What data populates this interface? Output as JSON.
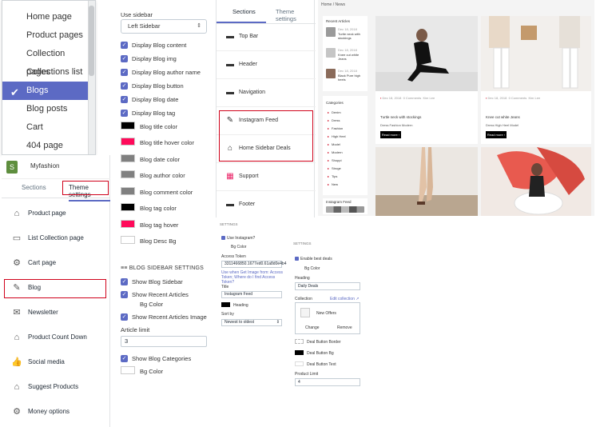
{
  "dropdown": {
    "items": [
      "Home page",
      "Product pages",
      "Collection pages",
      "Collections list",
      "Blogs",
      "Blog posts",
      "Cart",
      "404 page"
    ],
    "selected": "Blogs"
  },
  "left_panel": {
    "shop_name": "Myfashion",
    "tabs": [
      "Sections",
      "Theme settings"
    ],
    "items": [
      {
        "label": "Product page",
        "icon": "tag-icon"
      },
      {
        "label": "List Collection page",
        "icon": "book-icon"
      },
      {
        "label": "Cart page",
        "icon": "gear-icon"
      },
      {
        "label": "Blog",
        "icon": "edit-icon"
      },
      {
        "label": "Newsletter",
        "icon": "mail-icon"
      },
      {
        "label": "Product Count Down",
        "icon": "tag-icon"
      },
      {
        "label": "Social media",
        "icon": "thumbs-up-icon"
      },
      {
        "label": "Suggest Products",
        "icon": "tag-icon"
      },
      {
        "label": "Money options",
        "icon": "gear-icon"
      }
    ]
  },
  "blog_settings": {
    "use_sidebar_label": "Use sidebar",
    "use_sidebar_value": "Left Sidebar",
    "checks": [
      "Display Blog content",
      "Display Blog img",
      "Display Blog author name",
      "Display Blog button",
      "Display Blog date",
      "Display Blog tag"
    ],
    "colors": [
      {
        "label": "Blog title color",
        "color": "#000000"
      },
      {
        "label": "Blog title hover color",
        "color": "#ff0a5a"
      },
      {
        "label": "Blog date color",
        "color": "#808080"
      },
      {
        "label": "Blog author color",
        "color": "#808080"
      },
      {
        "label": "Blog comment color",
        "color": "#808080"
      },
      {
        "label": "Blog tag color",
        "color": "#000000"
      },
      {
        "label": "Blog tag hover",
        "color": "#ff0a5a"
      },
      {
        "label": "Blog Desc Bg",
        "color": "#ffffff"
      }
    ],
    "sidebar_section_title": "BLOG SIDEBAR SETTINGS",
    "show_blog_sidebar": "Show Blog Sidebar",
    "show_recent_articles": "Show Recent Articles",
    "bg_color": "Bg Color",
    "show_recent_image": "Show Recent Articles Image",
    "article_limit_label": "Article limit",
    "article_limit_value": "3",
    "show_categories": "Show Blog Categories",
    "bg_color_2": "Bg Color"
  },
  "sections_panel": {
    "tabs": [
      "Sections",
      "Theme settings"
    ],
    "items": [
      {
        "label": "Top Bar",
        "icon": "layout-icon"
      },
      {
        "label": "Header",
        "icon": "layout-icon"
      },
      {
        "label": "Navigation",
        "icon": "layout-icon"
      },
      {
        "label": "Instagram Feed",
        "icon": "edit-icon"
      },
      {
        "label": "Home Sidebar Deals",
        "icon": "store-icon"
      },
      {
        "label": "Support",
        "icon": "image-icon"
      },
      {
        "label": "Footer",
        "icon": "layout-icon"
      }
    ]
  },
  "preview": {
    "breadcrumb": "Home / News",
    "recent_title": "Recent Articles",
    "recent_items": [
      {
        "date": "Dec 18, 2018",
        "title": "Turtle neck with stockings"
      },
      {
        "date": "Dec 18, 2018",
        "title": "Knee cut white Jeans"
      },
      {
        "date": "Dec 18, 2018",
        "title": "Black Pure high heels"
      }
    ],
    "categories_title": "Categories",
    "categories": [
      "Denim",
      "Dress",
      "Fashion",
      "High Heel",
      "Model",
      "Modern",
      "Shoppi",
      "Stroge",
      "Tips",
      "New"
    ],
    "instagram_title": "Instagram Feed",
    "posts": [
      {
        "date": "Dec 18, 2018",
        "comments": "0 Comments",
        "author": "Kim Lee",
        "title": "Turtle neck with stockings",
        "tags": "Dress  Fashion  Modern",
        "btn": "Read more"
      },
      {
        "date": "Dec 18, 2018",
        "comments": "0 Comments",
        "author": "Kim Lee",
        "title": "Knee cut white Jeans",
        "tags": "Dress  High Heel  Model",
        "btn": "Read more"
      }
    ]
  },
  "instagram_settings": {
    "header": "SETTINGS",
    "use_instagram": "Use Instagram?",
    "bg_color": "Bg Color",
    "token_label": "Access Token",
    "token_value": "3311466850.1677ed0.61a8d0e4b4",
    "help": "Use when Get Image from: Access Token; Where do I find Access Token?",
    "title_label": "Title",
    "title_value": "Instagram Feed",
    "heading": "Heading",
    "sort_label": "Sort by",
    "sort_value": "Newest to oldest"
  },
  "deals_settings": {
    "header": "SETTINGS",
    "enable": "Enable best deals",
    "bg_color": "Bg Color",
    "heading_label": "Heading",
    "heading_value": "Daily Deals",
    "collection_label": "Collection",
    "edit_collection": "Edit collection",
    "collection_name": "New Offers",
    "change": "Change",
    "remove": "Remove",
    "deal_border": "Deal Button Border",
    "deal_bg": "Deal Button Bg",
    "deal_text": "Deal Button Text",
    "product_limit_label": "Product Limit",
    "product_limit_value": "4"
  }
}
